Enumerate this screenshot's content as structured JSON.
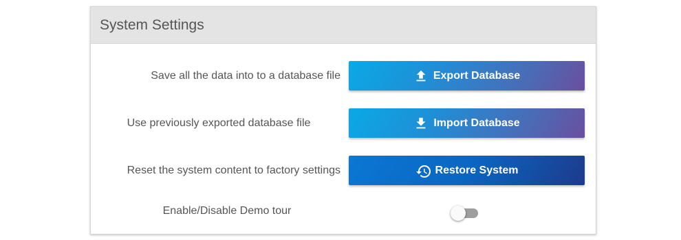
{
  "panel": {
    "title": "System Settings"
  },
  "rows": [
    {
      "label": "Save all the data into to a database file",
      "button_label": "Export Database",
      "icon": "upload-icon"
    },
    {
      "label": "Use previously exported database file",
      "button_label": "Import Database",
      "icon": "download-icon"
    },
    {
      "label": "Reset the system content to factory settings",
      "button_label": "Restore System",
      "icon": "restore-icon"
    }
  ],
  "demo_tour": {
    "label": "Enable/Disable Demo tour",
    "enabled": false
  },
  "colors": {
    "gradient_start": "#0aa9e6",
    "gradient_end": "#6a4f9e",
    "restore_start": "#0a78d4",
    "restore_end": "#1d3a8c",
    "toggle_track_off": "#9e9e9e"
  }
}
